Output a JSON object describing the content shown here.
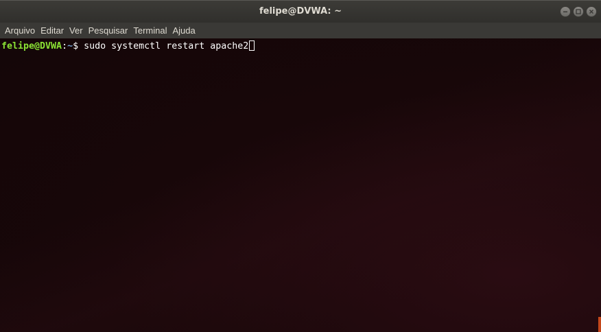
{
  "window": {
    "title": "felipe@DVWA: ~"
  },
  "menu": {
    "items": [
      "Arquivo",
      "Editar",
      "Ver",
      "Pesquisar",
      "Terminal",
      "Ajuda"
    ]
  },
  "terminal": {
    "prompt_user_host": "felipe@DVWA",
    "prompt_separator": ":",
    "prompt_path": "~",
    "prompt_symbol": "$ ",
    "command": "sudo systemctl restart apache2"
  },
  "colors": {
    "prompt_user": "#8ae234",
    "prompt_path": "#729fcf",
    "terminal_bg": "#180709",
    "titlebar_bg": "#3c3b37"
  },
  "icons": {
    "minimize": "minimize-icon",
    "maximize": "maximize-icon",
    "close": "close-icon"
  }
}
